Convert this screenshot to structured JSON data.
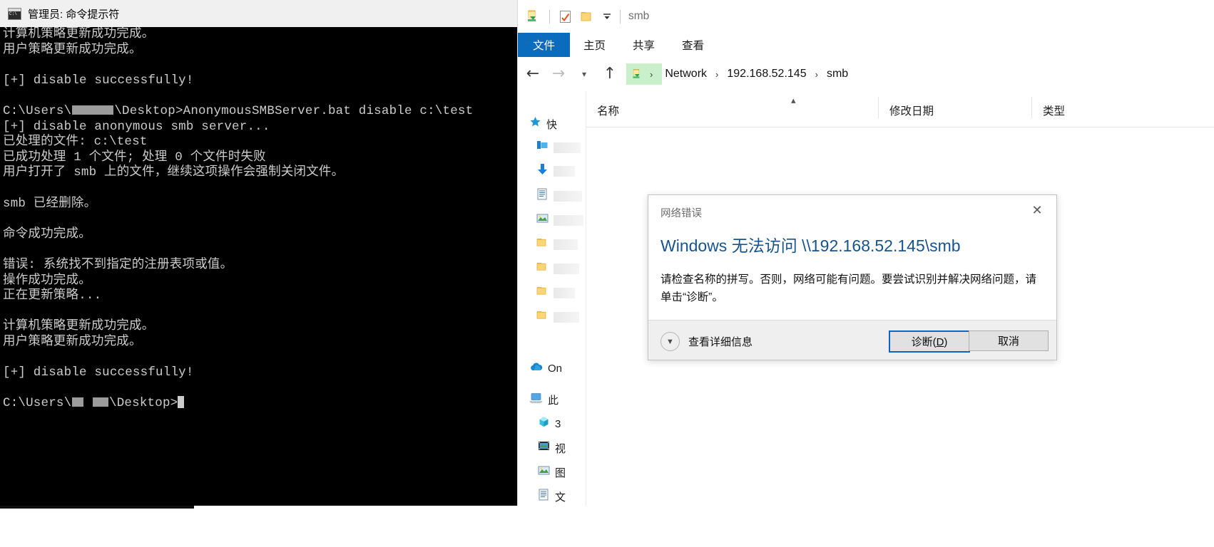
{
  "cmd": {
    "title": "管理员: 命令提示符",
    "icon": "console-icon",
    "lines": [
      {
        "t": "text",
        "v": "计算机策略更新成功完成。"
      },
      {
        "t": "text",
        "v": "用户策略更新成功完成。"
      },
      {
        "t": "blank",
        "v": ""
      },
      {
        "t": "text",
        "v": "[+] disable successfully!"
      },
      {
        "t": "blank",
        "v": ""
      },
      {
        "t": "prompt",
        "pre": "C:\\Users\\",
        "post": "\\Desktop>AnonymousSMBServer.bat disable c:\\test",
        "redacted": true
      },
      {
        "t": "text",
        "v": "[+] disable anonymous smb server..."
      },
      {
        "t": "text",
        "v": "已处理的文件: c:\\test"
      },
      {
        "t": "text",
        "v": "已成功处理 1 个文件; 处理 0 个文件时失败"
      },
      {
        "t": "text",
        "v": "用户打开了 smb 上的文件，继续这项操作会强制关闭文件。"
      },
      {
        "t": "blank",
        "v": ""
      },
      {
        "t": "text",
        "v": "smb 已经删除。"
      },
      {
        "t": "blank",
        "v": ""
      },
      {
        "t": "text",
        "v": "命令成功完成。"
      },
      {
        "t": "blank",
        "v": ""
      },
      {
        "t": "text",
        "v": "错误: 系统找不到指定的注册表项或值。"
      },
      {
        "t": "text",
        "v": "操作成功完成。"
      },
      {
        "t": "text",
        "v": "正在更新策略..."
      },
      {
        "t": "blank",
        "v": ""
      },
      {
        "t": "text",
        "v": "计算机策略更新成功完成。"
      },
      {
        "t": "text",
        "v": "用户策略更新成功完成。"
      },
      {
        "t": "blank",
        "v": ""
      },
      {
        "t": "text",
        "v": "[+] disable successfully!"
      },
      {
        "t": "blank",
        "v": ""
      },
      {
        "t": "prompt2",
        "pre": "C:\\Users\\",
        "post": "\\Desktop>",
        "redacted": true
      }
    ]
  },
  "explorer": {
    "titlebar": {
      "title": "smb",
      "qat": [
        {
          "name": "save-folder-icon",
          "label": "folder-down-icon"
        },
        {
          "name": "properties-icon",
          "label": "properties-icon"
        },
        {
          "name": "new-folder-icon",
          "label": "new-folder-icon"
        },
        {
          "name": "customize-qat-caret",
          "label": "chevron-down-icon"
        }
      ]
    },
    "ribbon_tabs": [
      {
        "label": "文件",
        "active": true
      },
      {
        "label": "主页",
        "active": false
      },
      {
        "label": "共享",
        "active": false
      },
      {
        "label": "查看",
        "active": false
      }
    ],
    "address": {
      "back_icon": "back-arrow-icon",
      "forward_icon": "forward-arrow-icon",
      "recent_icon": "chevron-down-icon",
      "up_icon": "up-arrow-icon",
      "breadcrumbs": [
        "Network",
        "192.168.52.145",
        "smb"
      ],
      "separator": "›"
    },
    "columns": [
      {
        "label": "名称"
      },
      {
        "label": "修改日期"
      },
      {
        "label": "类型"
      }
    ],
    "sidebar": [
      {
        "label": "快",
        "icon": "star-icon",
        "truncated": true
      },
      {
        "label": "",
        "icon": "desktop-icon",
        "blurred": true
      },
      {
        "label": "",
        "icon": "downloads-icon",
        "blurred": true
      },
      {
        "label": "",
        "icon": "documents-icon",
        "blurred": true
      },
      {
        "label": "",
        "icon": "pictures-icon",
        "blurred": true
      },
      {
        "label": "",
        "icon": "folder-icon",
        "blurred": true
      },
      {
        "label": "",
        "icon": "folder-icon",
        "blurred": true
      },
      {
        "label": "",
        "icon": "folder-icon",
        "blurred": true
      },
      {
        "label": "",
        "icon": "folder-icon",
        "blurred": true
      },
      {
        "label": "On",
        "icon": "onedrive-icon",
        "truncated": true
      },
      {
        "label": "此",
        "icon": "this-pc-icon",
        "truncated": true
      },
      {
        "label": "3",
        "icon": "3d-objects-icon",
        "truncated": true
      },
      {
        "label": "视",
        "icon": "videos-icon",
        "truncated": true
      },
      {
        "label": "图",
        "icon": "pictures-icon",
        "truncated": true
      },
      {
        "label": "文",
        "icon": "documents-icon",
        "truncated": true
      }
    ]
  },
  "dialog": {
    "caption": "网络错误",
    "close_icon": "close-icon",
    "heading": "Windows 无法访问 \\\\192.168.52.145\\smb",
    "body": "请检查名称的拼写。否则，网络可能有问题。要尝试识别并解决网络问题，请单击“诊断”。",
    "expander": {
      "icon": "chevron-down-circle-icon",
      "label": "查看详细信息"
    },
    "buttons": [
      {
        "label_pre": "诊断(",
        "accel": "D",
        "label_post": ")",
        "primary": true,
        "name": "diagnose-button"
      },
      {
        "label_pre": "取消",
        "accel": "",
        "label_post": "",
        "primary": false,
        "name": "cancel-button"
      }
    ]
  },
  "colors": {
    "ribbon_file_blue": "#0b6cbd",
    "dialog_heading_blue": "#16538f",
    "breadcrumb_highlight_green": "#c9f0cb",
    "primary_button_border": "#0a68c4",
    "console_bg": "#000000",
    "console_fg": "#cccccc"
  }
}
